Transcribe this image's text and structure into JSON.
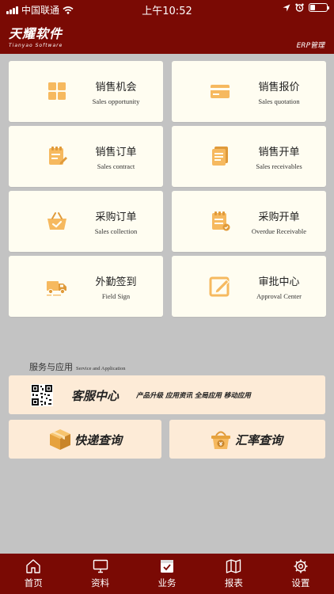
{
  "status_bar": {
    "carrier": "中国联通",
    "time": "上午10:52"
  },
  "header": {
    "brand_cn": "天耀软件",
    "brand_en": "Tianyao Software",
    "subtitle": "ERP管理"
  },
  "cards": [
    {
      "cn": "销售机会",
      "en": "Sales opportunity",
      "icon": "grid-icon"
    },
    {
      "cn": "销售报价",
      "en": "Sales quotation",
      "icon": "card-icon"
    },
    {
      "cn": "销售订单",
      "en": "Sales contract",
      "icon": "clipboard-edit-icon"
    },
    {
      "cn": "销售开单",
      "en": "Sales receivables",
      "icon": "stacked-documents-icon"
    },
    {
      "cn": "采购订单",
      "en": "Sales collection",
      "icon": "shopping-basket-icon"
    },
    {
      "cn": "采购开单",
      "en": "Overdue Receivable",
      "icon": "clipboard-list-icon"
    },
    {
      "cn": "外勤签到",
      "en": "Field Sign",
      "icon": "delivery-truck-icon"
    },
    {
      "cn": "审批中心",
      "en": "Approval Center",
      "icon": "edit-pen-icon"
    }
  ],
  "section": {
    "title_cn": "服务与应用",
    "title_en": "Service and Application"
  },
  "service_center": {
    "title": "客服中心",
    "subtitle": "产品升级 应用资讯 全局应用 移动应用"
  },
  "quick_links": [
    {
      "label": "快递查询",
      "icon": "package-box-icon"
    },
    {
      "label": "汇率查询",
      "icon": "exchange-basket-icon"
    }
  ],
  "tabs": [
    {
      "label": "首页",
      "icon": "home-icon"
    },
    {
      "label": "资料",
      "icon": "monitor-icon"
    },
    {
      "label": "业务",
      "icon": "briefcase-check-icon"
    },
    {
      "label": "报表",
      "icon": "map-icon"
    },
    {
      "label": "设置",
      "icon": "gear-icon"
    }
  ],
  "colors": {
    "brand_red": "#7a0a04",
    "background": "#c3c3c3",
    "card_bg": "#fffdf1",
    "accent_bg": "#fdebd7",
    "icon_orange": "#f6b95f"
  }
}
